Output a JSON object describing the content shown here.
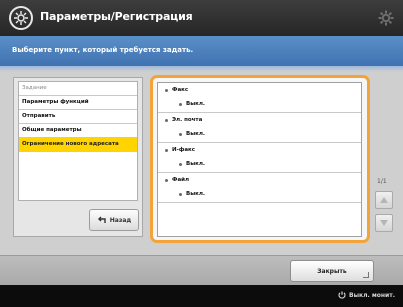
{
  "header": {
    "title": "Параметры/Регистрация",
    "icon": "settings-registration-icon",
    "settings_icon": "gear-icon"
  },
  "instruction": "Выберите пункт, который требуется задать.",
  "left_menu": {
    "items": [
      {
        "label": "Задание",
        "state": "dim"
      },
      {
        "label": "Параметры функций",
        "state": "normal"
      },
      {
        "label": "Отправить",
        "state": "normal"
      },
      {
        "label": "Общие параметры",
        "state": "normal"
      },
      {
        "label": "Ограничение нового адресата",
        "state": "selected"
      }
    ],
    "back_label": "Назад"
  },
  "right_list": {
    "items": [
      {
        "label": "Факс",
        "value": "Выкл."
      },
      {
        "label": "Эл. почта",
        "value": "Выкл."
      },
      {
        "label": "И-факс",
        "value": "Выкл."
      },
      {
        "label": "Файл",
        "value": "Выкл."
      }
    ]
  },
  "scroll": {
    "page_indicator": "1/1"
  },
  "footer": {
    "close_label": "Закрыть",
    "status_label": "Выкл. монит."
  },
  "colors": {
    "accent_orange": "#f2a43a",
    "selection_yellow": "#ffd400",
    "instruction_blue": "#4a7fbe"
  }
}
